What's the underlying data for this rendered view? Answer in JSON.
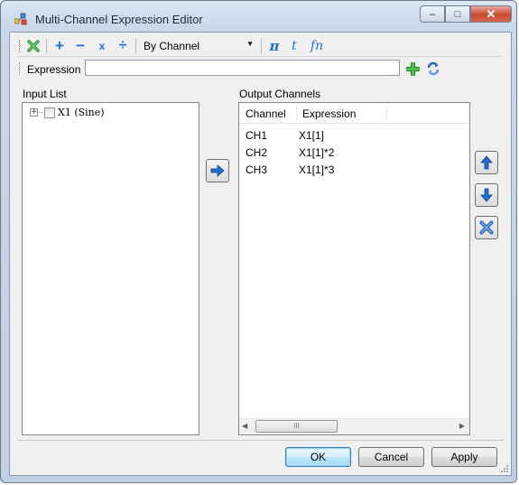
{
  "window": {
    "title": "Multi-Channel Expression Editor",
    "caption_buttons": {
      "minimize": "–",
      "maximize": "□",
      "close": "✕"
    }
  },
  "toolbar": {
    "icons": [
      "clear-icon",
      "plus-icon",
      "minus-icon",
      "multiply-icon",
      "divide-icon",
      "pi-icon",
      "t-icon",
      "fn-icon"
    ],
    "plus": "+",
    "minus": "−",
    "multiply": "x",
    "divide": "÷",
    "mode_dropdown": {
      "selected": "By Channel"
    },
    "pi": "π",
    "t": "t",
    "fn": "fn"
  },
  "expression": {
    "label": "Expression",
    "value": "",
    "placeholder": ""
  },
  "input_list": {
    "label": "Input List",
    "items": [
      {
        "expander": "+",
        "label": "X1 (Sine)",
        "checked": false
      }
    ]
  },
  "output_channels": {
    "label": "Output Channels",
    "columns": [
      "Channel",
      "Expression"
    ],
    "rows": [
      {
        "channel": "CH1",
        "expression": "X1[1]"
      },
      {
        "channel": "CH2",
        "expression": "X1[1]*2"
      },
      {
        "channel": "CH3",
        "expression": "X1[1]*3"
      }
    ],
    "scroll_thumb_grip": "III"
  },
  "buttons": {
    "ok": "OK",
    "cancel": "Cancel",
    "apply": "Apply"
  },
  "colors": {
    "accent_blue": "#1f6fd6",
    "add_green": "#2ea82e",
    "clear_green": "#2f9e3b"
  }
}
